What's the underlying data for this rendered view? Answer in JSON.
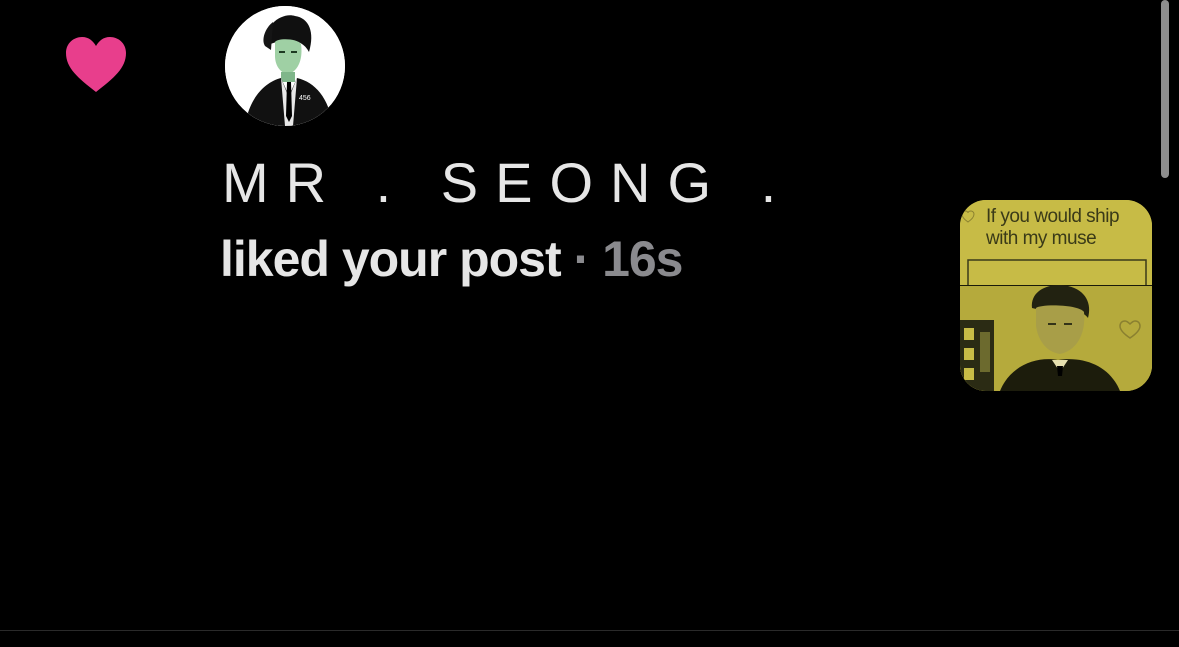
{
  "notification": {
    "icon": "heart-icon",
    "icon_color": "#e83e8c",
    "username": "MR .   SEONG .",
    "action": "liked your post",
    "separator": " · ",
    "time": "16s",
    "avatar_badge": "456",
    "post_thumbnail": {
      "caption": "If you would ship\nwith my muse",
      "background_color": "#c7bb46"
    }
  }
}
